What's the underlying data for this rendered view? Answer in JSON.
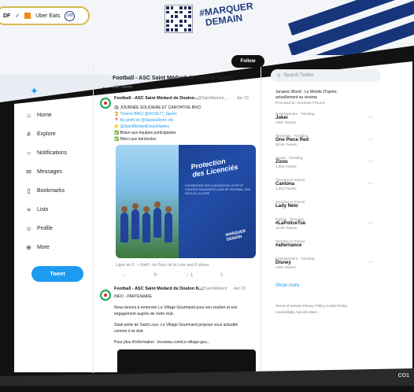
{
  "banner": {
    "sponsors": [
      "DF",
      "✓",
      "Uber Eats",
      "VW"
    ],
    "hashtag_line1": "#MARQUER",
    "hashtag_line2": "DEMAIN"
  },
  "sidebar": {
    "items": [
      {
        "label": "Home",
        "icon": "home-icon",
        "glyph": "⌂"
      },
      {
        "label": "Explore",
        "icon": "hashtag-icon",
        "glyph": "#"
      },
      {
        "label": "Notifications",
        "icon": "bell-icon",
        "glyph": "○"
      },
      {
        "label": "Messages",
        "icon": "envelope-icon",
        "glyph": "✉"
      },
      {
        "label": "Bookmarks",
        "icon": "bookmark-icon",
        "glyph": "▯"
      },
      {
        "label": "Lists",
        "icon": "list-icon",
        "glyph": "≡"
      },
      {
        "label": "Profile",
        "icon": "person-icon",
        "glyph": "☺"
      },
      {
        "label": "More",
        "icon": "more-icon",
        "glyph": "⊕"
      }
    ],
    "tweet_button": "Tweet"
  },
  "feed": {
    "title": "Football - ASC Saint Médard de Doulon Nantes",
    "subtitle": "412 Tweets",
    "follow_label": "Follow",
    "tweet1": {
      "author": "Football - ASC Saint Médard de Doulon...",
      "handle": "@SaintMedard_...",
      "date": "Apr 23",
      "lines": [
        "⚽ JOURNÉE SOLIDAIRE ET CARITATIVE BNCI",
        "🏆 Tournoi BNCI @ASSE77_Sports",
        "📍 Au profit de @NantesRetro etc",
        "👉 @SaintMedardDouloNantes",
        "✅ Bravo aux équipes participantes",
        "✅ Merci aux bénévoles"
      ],
      "media": {
        "title_line1": "Protection",
        "title_line2": "des Licenciés",
        "body": "CONVENTION DES LICENCIÉS DE LA FFF ET CONTRAT-SOLIDARITÉ LIGUE DE FOOTBALL DES PAYS DE LA LOIRE",
        "foot": "MARQUER DEMAIN"
      },
      "caption": "Ligue de F... • Natif - du Pays de la Loire and 8 others",
      "actions": [
        "…",
        "↻",
        "♡ 1",
        "⇪"
      ]
    },
    "tweet2": {
      "author": "Football - ASC Saint Médard de Doulon N...",
      "handle": "@SaintMédard",
      "date": "Apr 18",
      "tag": "INFO - PARTENAIRE",
      "lines": [
        "Nous tenons à remercier Le Village Gourmand pour son soutien et son",
        "engagement auprès de notre club.",
        "",
        "Situé porte de Saint Luce, Le Village Gourmand propose vous actualité",
        "comme il se doit.",
        "",
        "Pour plus d'information : lecoteau.com/Le-village-gou..."
      ]
    }
  },
  "right": {
    "search_placeholder": "Search Twitter",
    "promo_lines": [
      "Jurassic World : Le Monde D'après,",
      "actuellement au cinéma",
      "Promoted by Universal Pictures"
    ],
    "trends": [
      {
        "cat": "Entertainment · Trending",
        "name": "Joker",
        "count": "100K Tweets"
      },
      {
        "cat": "Television · Trending",
        "name": "One Piece Red",
        "count": "68.6K Tweets"
      },
      {
        "cat": "Sports · Trending",
        "name": "Zizou",
        "count": "1,884 Tweets"
      },
      {
        "cat": "Trending in France",
        "name": "Cantona",
        "count": "2,853 Tweets"
      },
      {
        "cat": "Trending in France",
        "name": "Lady Nelo",
        "count": ""
      },
      {
        "cat": "Politics · Trending",
        "name": "#LaPoliceTue",
        "count": "18.5K Tweets"
      },
      {
        "cat": "Trending in France",
        "name": "#alternance",
        "count": ""
      },
      {
        "cat": "Entertainment · Trending",
        "name": "Disney",
        "count": "100K Tweets"
      }
    ],
    "show_more": "Show more",
    "footer_line1": "Terms of Service   Privacy Policy   Cookie Policy",
    "footer_line2": "Accessibility   Ads info   More …"
  },
  "bottom_text": "CO1"
}
